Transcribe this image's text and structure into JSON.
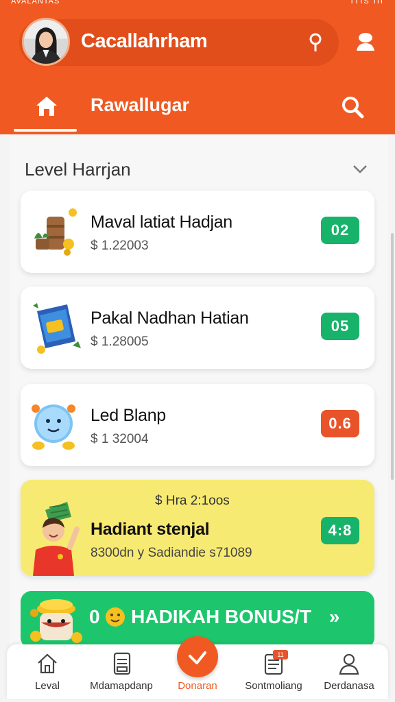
{
  "status_bar": {
    "left": "AVALANTAS",
    "right": "ITIS III"
  },
  "profile": {
    "name": "Cacallahrham"
  },
  "nav": {
    "title": "Rawallugar"
  },
  "section": {
    "title": "Level Harrjan"
  },
  "cards": [
    {
      "title": "Maval latiat Hadjan",
      "subtitle": "$ 1.22003",
      "badge": "02",
      "badge_color": "#17b36a"
    },
    {
      "title": "Pakal Nadhan Hatian",
      "subtitle": "$ 1.28005",
      "badge": "05",
      "badge_color": "#17b36a"
    },
    {
      "title": "Led Blanp",
      "subtitle": "$ 1 32004",
      "badge": "0.6",
      "badge_color": "#e9532a"
    },
    {
      "top_text": "$ Hra 2:1oos",
      "title": "Hadiant stenjal",
      "subtitle": "8300dn y Sadiandie s71089",
      "badge": "4:8",
      "badge_color": "#17b36a"
    }
  ],
  "bonus": {
    "text": "HADIKAH BONUS/T",
    "prefix": "0",
    "suffix": "»"
  },
  "bottom_nav": {
    "items": [
      {
        "label": "Leval",
        "icon": "home-icon"
      },
      {
        "label": "Mdamapdanp",
        "icon": "tablet-icon"
      },
      {
        "label": "Donaran",
        "icon": "check-icon"
      },
      {
        "label": "Sontmoliang",
        "icon": "list-icon",
        "badge": "11"
      },
      {
        "label": "Derdanasa",
        "icon": "user-icon"
      }
    ]
  },
  "colors": {
    "primary": "#f05a22",
    "green": "#17b36a",
    "yellow": "#f7ea72"
  }
}
